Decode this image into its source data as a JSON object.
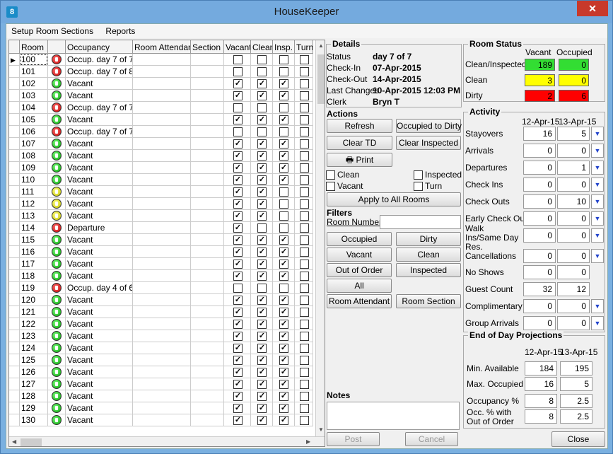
{
  "window": {
    "title": "HouseKeeper",
    "close_label": "✕"
  },
  "menu": [
    "Setup Room Sections",
    "Reports"
  ],
  "grid": {
    "columns": [
      "Room",
      "",
      "Occupancy",
      "Room Attendant",
      "Section",
      "Vacant",
      "Clean",
      "Insp.",
      "Turn"
    ],
    "rows": [
      {
        "room": "100",
        "status": "red",
        "occupancy": "Occup. day 7 of 7",
        "vacant": false,
        "clean": false,
        "insp": false,
        "turn": false
      },
      {
        "room": "101",
        "status": "red",
        "occupancy": "Occup. day 7 of 8",
        "vacant": false,
        "clean": false,
        "insp": false,
        "turn": false
      },
      {
        "room": "102",
        "status": "green",
        "occupancy": "Vacant",
        "vacant": true,
        "clean": true,
        "insp": true,
        "turn": false
      },
      {
        "room": "103",
        "status": "green",
        "occupancy": "Vacant",
        "vacant": true,
        "clean": true,
        "insp": true,
        "turn": false
      },
      {
        "room": "104",
        "status": "red",
        "occupancy": "Occup. day 7 of 7",
        "vacant": false,
        "clean": false,
        "insp": false,
        "turn": false
      },
      {
        "room": "105",
        "status": "green",
        "occupancy": "Vacant",
        "vacant": true,
        "clean": true,
        "insp": true,
        "turn": false
      },
      {
        "room": "106",
        "status": "red",
        "occupancy": "Occup. day 7 of 7",
        "vacant": false,
        "clean": false,
        "insp": false,
        "turn": false
      },
      {
        "room": "107",
        "status": "green",
        "occupancy": "Vacant",
        "vacant": true,
        "clean": true,
        "insp": true,
        "turn": false
      },
      {
        "room": "108",
        "status": "green",
        "occupancy": "Vacant",
        "vacant": true,
        "clean": true,
        "insp": true,
        "turn": false
      },
      {
        "room": "109",
        "status": "green",
        "occupancy": "Vacant",
        "vacant": true,
        "clean": true,
        "insp": true,
        "turn": false
      },
      {
        "room": "110",
        "status": "green",
        "occupancy": "Vacant",
        "vacant": true,
        "clean": true,
        "insp": true,
        "turn": false
      },
      {
        "room": "111",
        "status": "yellow",
        "occupancy": "Vacant",
        "vacant": true,
        "clean": true,
        "insp": false,
        "turn": false
      },
      {
        "room": "112",
        "status": "yellow",
        "occupancy": "Vacant",
        "vacant": true,
        "clean": true,
        "insp": false,
        "turn": false
      },
      {
        "room": "113",
        "status": "yellow",
        "occupancy": "Vacant",
        "vacant": true,
        "clean": true,
        "insp": false,
        "turn": false
      },
      {
        "room": "114",
        "status": "red",
        "occupancy": "Departure",
        "vacant": true,
        "clean": false,
        "insp": false,
        "turn": false
      },
      {
        "room": "115",
        "status": "green",
        "occupancy": "Vacant",
        "vacant": true,
        "clean": true,
        "insp": true,
        "turn": false
      },
      {
        "room": "116",
        "status": "green",
        "occupancy": "Vacant",
        "vacant": true,
        "clean": true,
        "insp": true,
        "turn": false
      },
      {
        "room": "117",
        "status": "green",
        "occupancy": "Vacant",
        "vacant": true,
        "clean": true,
        "insp": true,
        "turn": false
      },
      {
        "room": "118",
        "status": "green",
        "occupancy": "Vacant",
        "vacant": true,
        "clean": true,
        "insp": true,
        "turn": false
      },
      {
        "room": "119",
        "status": "red",
        "occupancy": "Occup. day 4 of 6",
        "vacant": false,
        "clean": false,
        "insp": false,
        "turn": false
      },
      {
        "room": "120",
        "status": "green",
        "occupancy": "Vacant",
        "vacant": true,
        "clean": true,
        "insp": true,
        "turn": false
      },
      {
        "room": "121",
        "status": "green",
        "occupancy": "Vacant",
        "vacant": true,
        "clean": true,
        "insp": true,
        "turn": false
      },
      {
        "room": "122",
        "status": "green",
        "occupancy": "Vacant",
        "vacant": true,
        "clean": true,
        "insp": true,
        "turn": false
      },
      {
        "room": "123",
        "status": "green",
        "occupancy": "Vacant",
        "vacant": true,
        "clean": true,
        "insp": true,
        "turn": false
      },
      {
        "room": "124",
        "status": "green",
        "occupancy": "Vacant",
        "vacant": true,
        "clean": true,
        "insp": true,
        "turn": false
      },
      {
        "room": "125",
        "status": "green",
        "occupancy": "Vacant",
        "vacant": true,
        "clean": true,
        "insp": true,
        "turn": false
      },
      {
        "room": "126",
        "status": "green",
        "occupancy": "Vacant",
        "vacant": true,
        "clean": true,
        "insp": true,
        "turn": false
      },
      {
        "room": "127",
        "status": "green",
        "occupancy": "Vacant",
        "vacant": true,
        "clean": true,
        "insp": true,
        "turn": false
      },
      {
        "room": "128",
        "status": "green",
        "occupancy": "Vacant",
        "vacant": true,
        "clean": true,
        "insp": true,
        "turn": false
      },
      {
        "room": "129",
        "status": "green",
        "occupancy": "Vacant",
        "vacant": true,
        "clean": true,
        "insp": true,
        "turn": false
      },
      {
        "room": "130",
        "status": "green",
        "occupancy": "Vacant",
        "vacant": true,
        "clean": true,
        "insp": true,
        "turn": false
      }
    ]
  },
  "details": {
    "title": "Details",
    "status_label": "Status",
    "status": "day 7 of 7",
    "checkin_label": "Check-In",
    "checkin": "07-Apr-2015",
    "checkout_label": "Check-Out",
    "checkout": "14-Apr-2015",
    "last_label": "Last Changes",
    "last": "10-Apr-2015 12:03 PM",
    "clerk_label": "Clerk",
    "clerk": "Bryn T"
  },
  "actions": {
    "title": "Actions",
    "refresh": "Refresh",
    "occ_dirty": "Occupied to Dirty",
    "clear_td": "Clear TD",
    "clear_insp": "Clear Inspected",
    "print": "Print",
    "clean": "Clean",
    "inspected": "Inspected",
    "vacant": "Vacant",
    "turn": "Turn",
    "apply": "Apply to All Rooms"
  },
  "filters": {
    "title": "Filters",
    "room_number_label": "Room Number",
    "room_number": "",
    "occupied": "Occupied",
    "dirty": "Dirty",
    "vacant": "Vacant",
    "clean": "Clean",
    "out_of_order": "Out of Order",
    "inspected": "Inspected",
    "all": "All",
    "room_attendant": "Room Attendant",
    "room_section": "Room Section"
  },
  "notes": {
    "title": "Notes",
    "value": ""
  },
  "post": "Post",
  "cancel": "Cancel",
  "close": "Close",
  "room_status": {
    "title": "Room Status",
    "col_vacant": "Vacant",
    "col_occupied": "Occupied",
    "rows": [
      {
        "label": "Clean/Inspected",
        "vacant": "189",
        "occupied": "0",
        "color": "#33dd33"
      },
      {
        "label": "Clean",
        "vacant": "3",
        "occupied": "0",
        "color": "#ffff00"
      },
      {
        "label": "Dirty",
        "vacant": "2",
        "occupied": "6",
        "color": "#ff0000"
      }
    ]
  },
  "activity": {
    "title": "Activity",
    "date1": "12-Apr-15",
    "date2": "13-Apr-15",
    "rows": [
      {
        "label": "Stayovers",
        "v1": "16",
        "v2": "5",
        "dd": true
      },
      {
        "label": "Arrivals",
        "v1": "0",
        "v2": "0",
        "dd": true
      },
      {
        "label": "Departures",
        "v1": "0",
        "v2": "1",
        "dd": true
      },
      {
        "label": "Check Ins",
        "v1": "0",
        "v2": "0",
        "dd": true
      },
      {
        "label": "Check Outs",
        "v1": "0",
        "v2": "10",
        "dd": true
      },
      {
        "label": "Early Check Outs",
        "v1": "0",
        "v2": "0",
        "dd": true
      },
      {
        "label": "Walk Ins/Same Day Res.",
        "v1": "0",
        "v2": "0",
        "dd": true
      },
      {
        "label": "Cancellations",
        "v1": "0",
        "v2": "0",
        "dd": true
      },
      {
        "label": "No Shows",
        "v1": "0",
        "v2": "0",
        "dd": false
      },
      {
        "label": "Guest Count",
        "v1": "32",
        "v2": "12",
        "dd": false
      },
      {
        "label": "Complimentary",
        "v1": "0",
        "v2": "0",
        "dd": true
      },
      {
        "label": "Group Arrivals",
        "v1": "0",
        "v2": "0",
        "dd": true
      }
    ]
  },
  "eod": {
    "title": "End of Day Projections",
    "date1": "12-Apr-15",
    "date2": "13-Apr-15",
    "rows": [
      {
        "label": "Min. Available",
        "v1": "184",
        "v2": "195"
      },
      {
        "label": "Max. Occupied",
        "v1": "16",
        "v2": "5"
      },
      {
        "label": "Occupancy %",
        "v1": "8",
        "v2": "2.5"
      },
      {
        "label": "Occ. % with Out of Order",
        "v1": "8",
        "v2": "2.5"
      }
    ]
  }
}
